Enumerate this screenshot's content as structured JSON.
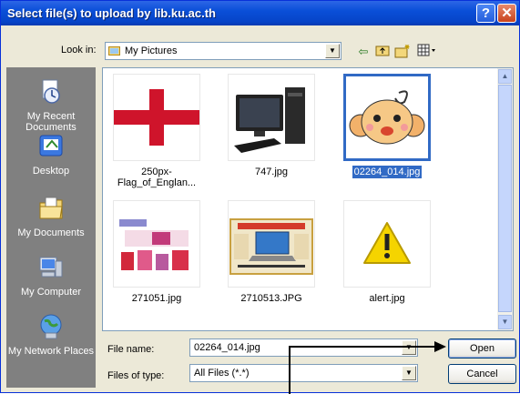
{
  "window": {
    "title": "Select file(s) to upload by lib.ku.ac.th"
  },
  "titlebar_buttons": {
    "help": "?",
    "close": "✕"
  },
  "toolbar": {
    "look_in_label": "Look in:",
    "look_in_value": "My Pictures",
    "icons": [
      "back-icon",
      "up-folder-icon",
      "new-folder-icon",
      "view-menu-icon"
    ]
  },
  "places": [
    {
      "label": "My Recent Documents",
      "icon": "recent-documents-icon"
    },
    {
      "label": "Desktop",
      "icon": "desktop-icon"
    },
    {
      "label": "My Documents",
      "icon": "my-documents-icon"
    },
    {
      "label": "My Computer",
      "icon": "my-computer-icon"
    },
    {
      "label": "My Network Places",
      "icon": "network-places-icon"
    }
  ],
  "files": [
    {
      "name": "250px-Flag_of_Englan...",
      "thumb": "flag-of-england"
    },
    {
      "name": "747.jpg",
      "thumb": "computer-photo"
    },
    {
      "name": "02264_014.jpg",
      "thumb": "monkey-cartoon",
      "selected": true
    },
    {
      "name": "271051.jpg",
      "thumb": "collage-image"
    },
    {
      "name": "2710513.JPG",
      "thumb": "laptop-loan-poster"
    },
    {
      "name": "alert.jpg",
      "thumb": "alert-warning-icon"
    }
  ],
  "fields": {
    "file_name_label": "File name:",
    "file_name_value": "02264_014.jpg",
    "files_of_type_label": "Files of type:",
    "files_of_type_value": "All Files (*.*)"
  },
  "buttons": {
    "open": "Open",
    "cancel": "Cancel"
  },
  "colors": {
    "titlebar": "#0a4fd8",
    "selection": "#316ac5",
    "places_bar": "#808080",
    "dialog_bg": "#ece9d8"
  }
}
